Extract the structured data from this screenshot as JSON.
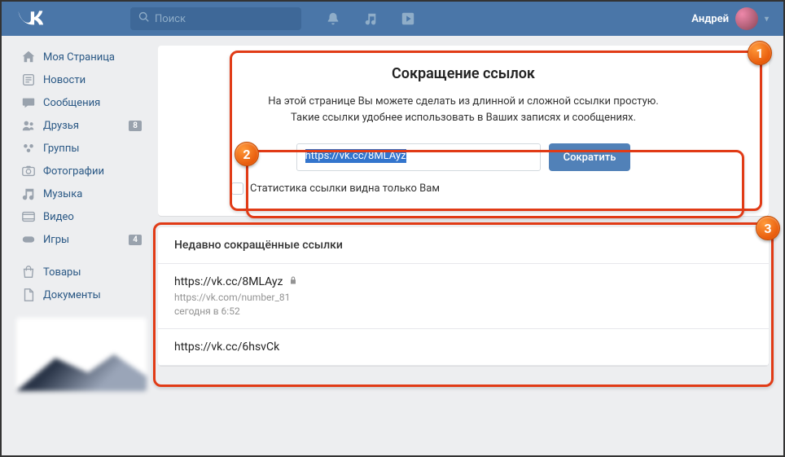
{
  "header": {
    "search_placeholder": "Поиск",
    "username": "Андрей"
  },
  "sidebar": {
    "items": [
      {
        "label": "Моя Страница",
        "icon": "home",
        "badge": null
      },
      {
        "label": "Новости",
        "icon": "news",
        "badge": null
      },
      {
        "label": "Сообщения",
        "icon": "msg",
        "badge": null
      },
      {
        "label": "Друзья",
        "icon": "friends",
        "badge": "8"
      },
      {
        "label": "Группы",
        "icon": "groups",
        "badge": null
      },
      {
        "label": "Фотографии",
        "icon": "photo",
        "badge": null
      },
      {
        "label": "Музыка",
        "icon": "music",
        "badge": null
      },
      {
        "label": "Видео",
        "icon": "video",
        "badge": null
      },
      {
        "label": "Игры",
        "icon": "games",
        "badge": "4"
      }
    ],
    "items2": [
      {
        "label": "Товары",
        "icon": "market"
      },
      {
        "label": "Документы",
        "icon": "docs"
      }
    ]
  },
  "shortener": {
    "title": "Сокращение ссылок",
    "desc1": "На этой странице Вы можете сделать из длинной и сложной ссылки простую.",
    "desc2": "Такие ссылки удобнее использовать в Ваших записях и сообщениях.",
    "input_value": "https://vk.cc/8MLAyz",
    "submit": "Сократить",
    "private_label": "Статистика ссылки видна только Вам"
  },
  "recent": {
    "header": "Недавно сокращённые ссылки",
    "items": [
      {
        "short": "https://vk.cc/8MLAyz",
        "orig": "https://vk.com/number_81",
        "ts": "сегодня в 6:52",
        "locked": true
      },
      {
        "short": "https://vk.cc/6hsvCk",
        "orig": "",
        "ts": "",
        "locked": false
      }
    ]
  },
  "annotations": {
    "n1": "1",
    "n2": "2",
    "n3": "3"
  }
}
